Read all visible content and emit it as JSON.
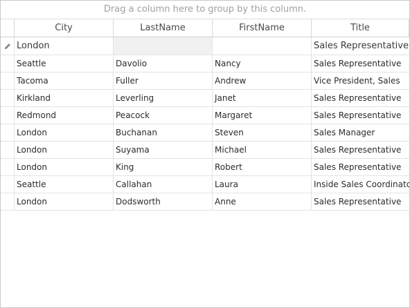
{
  "group_panel": {
    "text": "Drag a column here to group by this column."
  },
  "columns": [
    "City",
    "LastName",
    "FirstName",
    "Title"
  ],
  "new_row": {
    "city": "London",
    "last": "",
    "first": "",
    "title": "Sales Representative"
  },
  "rows": [
    [
      "Seattle",
      "Davolio",
      "Nancy",
      "Sales Representative"
    ],
    [
      "Tacoma",
      "Fuller",
      "Andrew",
      "Vice President, Sales"
    ],
    [
      "Kirkland",
      "Leverling",
      "Janet",
      "Sales Representative"
    ],
    [
      "Redmond",
      "Peacock",
      "Margaret",
      "Sales Representative"
    ],
    [
      "London",
      "Buchanan",
      "Steven",
      "Sales Manager"
    ],
    [
      "London",
      "Suyama",
      "Michael",
      "Sales Representative"
    ],
    [
      "London",
      "King",
      "Robert",
      "Sales Representative"
    ],
    [
      "Seattle",
      "Callahan",
      "Laura",
      "Inside Sales Coordinator"
    ],
    [
      "London",
      "Dodsworth",
      "Anne",
      "Sales Representative"
    ]
  ]
}
